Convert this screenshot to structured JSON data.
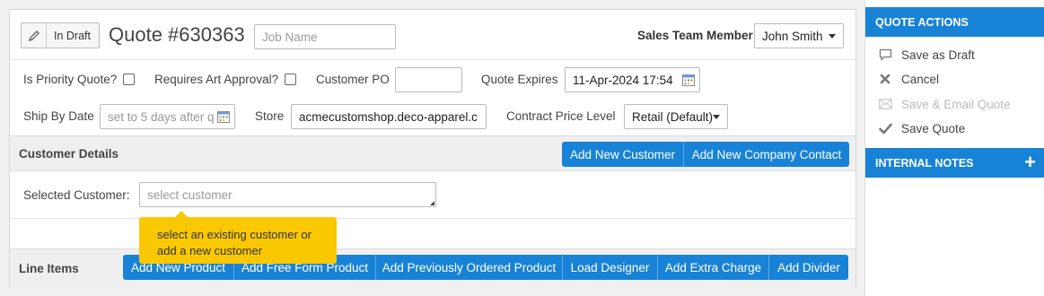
{
  "header": {
    "status_badge": "In Draft",
    "quote_title": "Quote #630363",
    "job_name_placeholder": "Job Name",
    "sales_team_label": "Sales Team Member",
    "sales_team_value": "John Smith"
  },
  "options": {
    "priority_label": "Is Priority Quote?",
    "art_approval_label": "Requires Art Approval?",
    "customer_po_label": "Customer PO",
    "customer_po_value": "",
    "quote_expires_label": "Quote Expires",
    "quote_expires_value": "11-Apr-2024 17:54",
    "ship_by_label": "Ship By Date",
    "ship_by_placeholder": "set to 5 days after q",
    "store_label": "Store",
    "store_value": "acmecustomshop.deco-apparel.c",
    "contract_price_label": "Contract Price Level",
    "contract_price_value": "Retail (Default)"
  },
  "customer_details": {
    "title": "Customer Details",
    "add_customer_button": "Add New Customer",
    "add_contact_button": "Add New Company Contact",
    "selected_label": "Selected Customer:",
    "select_placeholder": "select customer",
    "tooltip": "select an existing customer or add a new customer"
  },
  "line_items": {
    "title": "Line Items",
    "buttons": [
      "Add New Product",
      "Add Free Form Product",
      "Add Previously Ordered Product",
      "Load Designer",
      "Add Extra Charge",
      "Add Divider"
    ]
  },
  "sidebar": {
    "quote_actions_title": "QUOTE ACTIONS",
    "actions": [
      {
        "label": "Save as Draft",
        "icon": "speech-bubble-icon"
      },
      {
        "label": "Cancel",
        "icon": "close-icon"
      },
      {
        "label": "Save & Email Quote",
        "icon": "envelope-icon"
      },
      {
        "label": "Save Quote",
        "icon": "checkmark-icon"
      }
    ],
    "internal_notes_title": "INTERNAL NOTES",
    "add_note_symbol": "+"
  },
  "colors": {
    "primary": "#1883d6",
    "tooltip": "#fac800"
  }
}
